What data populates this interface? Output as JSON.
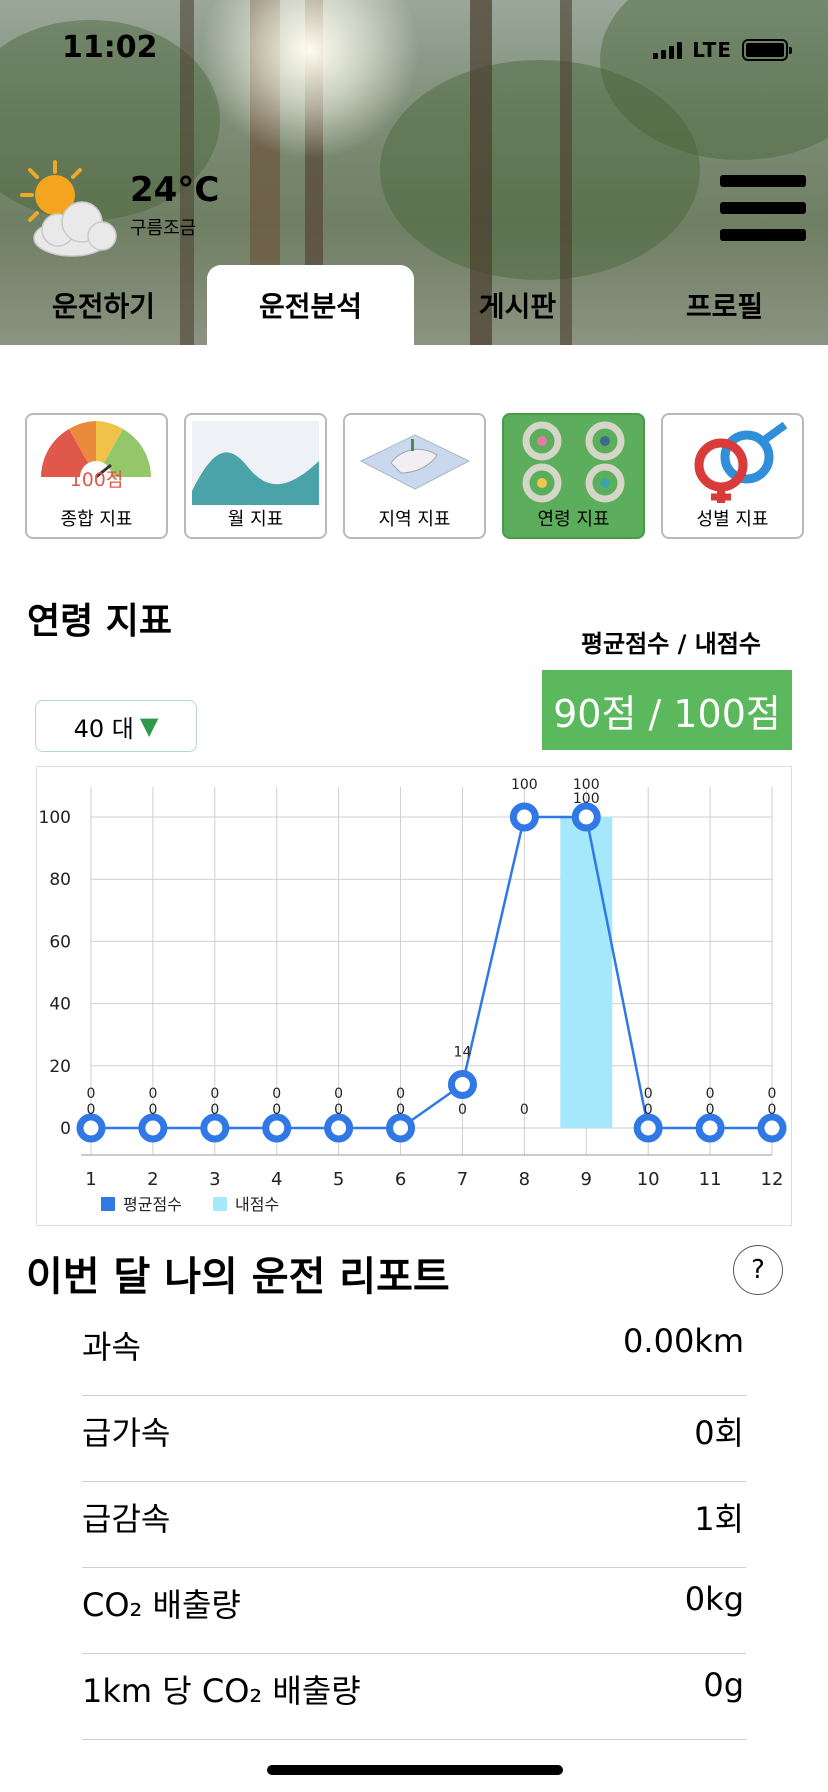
{
  "status": {
    "time": "11:02",
    "network": "LTE"
  },
  "weather": {
    "temperature": "24°C",
    "condition": "구름조금",
    "icon": "partly-cloudy-icon"
  },
  "tabs": [
    {
      "label": "운전하기",
      "active": false
    },
    {
      "label": "운전분석",
      "active": true
    },
    {
      "label": "게시판",
      "active": false
    },
    {
      "label": "프로필",
      "active": false
    }
  ],
  "categories": [
    {
      "label": "종합 지표",
      "thumb_text": "100점",
      "active": false
    },
    {
      "label": "월 지표",
      "active": false
    },
    {
      "label": "지역 지표",
      "active": false
    },
    {
      "label": "연령 지표",
      "active": true
    },
    {
      "label": "성별 지표",
      "active": false
    }
  ],
  "section_title": "연령 지표",
  "score_caption": "평균점수 / 내점수",
  "score_value": "90점 / 100점",
  "age_select": {
    "value": "40 대"
  },
  "chart_data": {
    "type": "line",
    "categories": [
      "1",
      "2",
      "3",
      "4",
      "5",
      "6",
      "7",
      "8",
      "9",
      "10",
      "11",
      "12"
    ],
    "ylim": [
      0,
      100
    ],
    "yticks": [
      "0",
      "20",
      "40",
      "60",
      "80",
      "100"
    ],
    "series": [
      {
        "name": "평균점수",
        "kind": "line",
        "color": "#2f78e6",
        "values": [
          0,
          0,
          0,
          0,
          0,
          0,
          14,
          100,
          100,
          0,
          0,
          0
        ],
        "labels": [
          "0",
          "0",
          "0",
          "0",
          "0",
          "0",
          "14",
          "100",
          "100",
          "0",
          "0",
          "0"
        ]
      },
      {
        "name": "내점수",
        "kind": "bar",
        "color": "#a6e8fb",
        "values": [
          0,
          0,
          0,
          0,
          0,
          0,
          0,
          0,
          100,
          0,
          0,
          0
        ],
        "labels": [
          "0",
          "0",
          "0",
          "0",
          "0",
          "0",
          "0",
          "0",
          "100",
          "0",
          "0",
          "0"
        ]
      }
    ],
    "legend": "bottom-left"
  },
  "report": {
    "title": "이번 달 나의 운전 리포트",
    "help": "?",
    "rows": [
      {
        "label": "과속",
        "value": "0.00km"
      },
      {
        "label": "급가속",
        "value": "0회"
      },
      {
        "label": "급감속",
        "value": "1회"
      },
      {
        "label": "CO₂ 배출량",
        "value": "0kg"
      },
      {
        "label": "1km 당 CO₂ 배출량",
        "value": "0g"
      }
    ]
  }
}
